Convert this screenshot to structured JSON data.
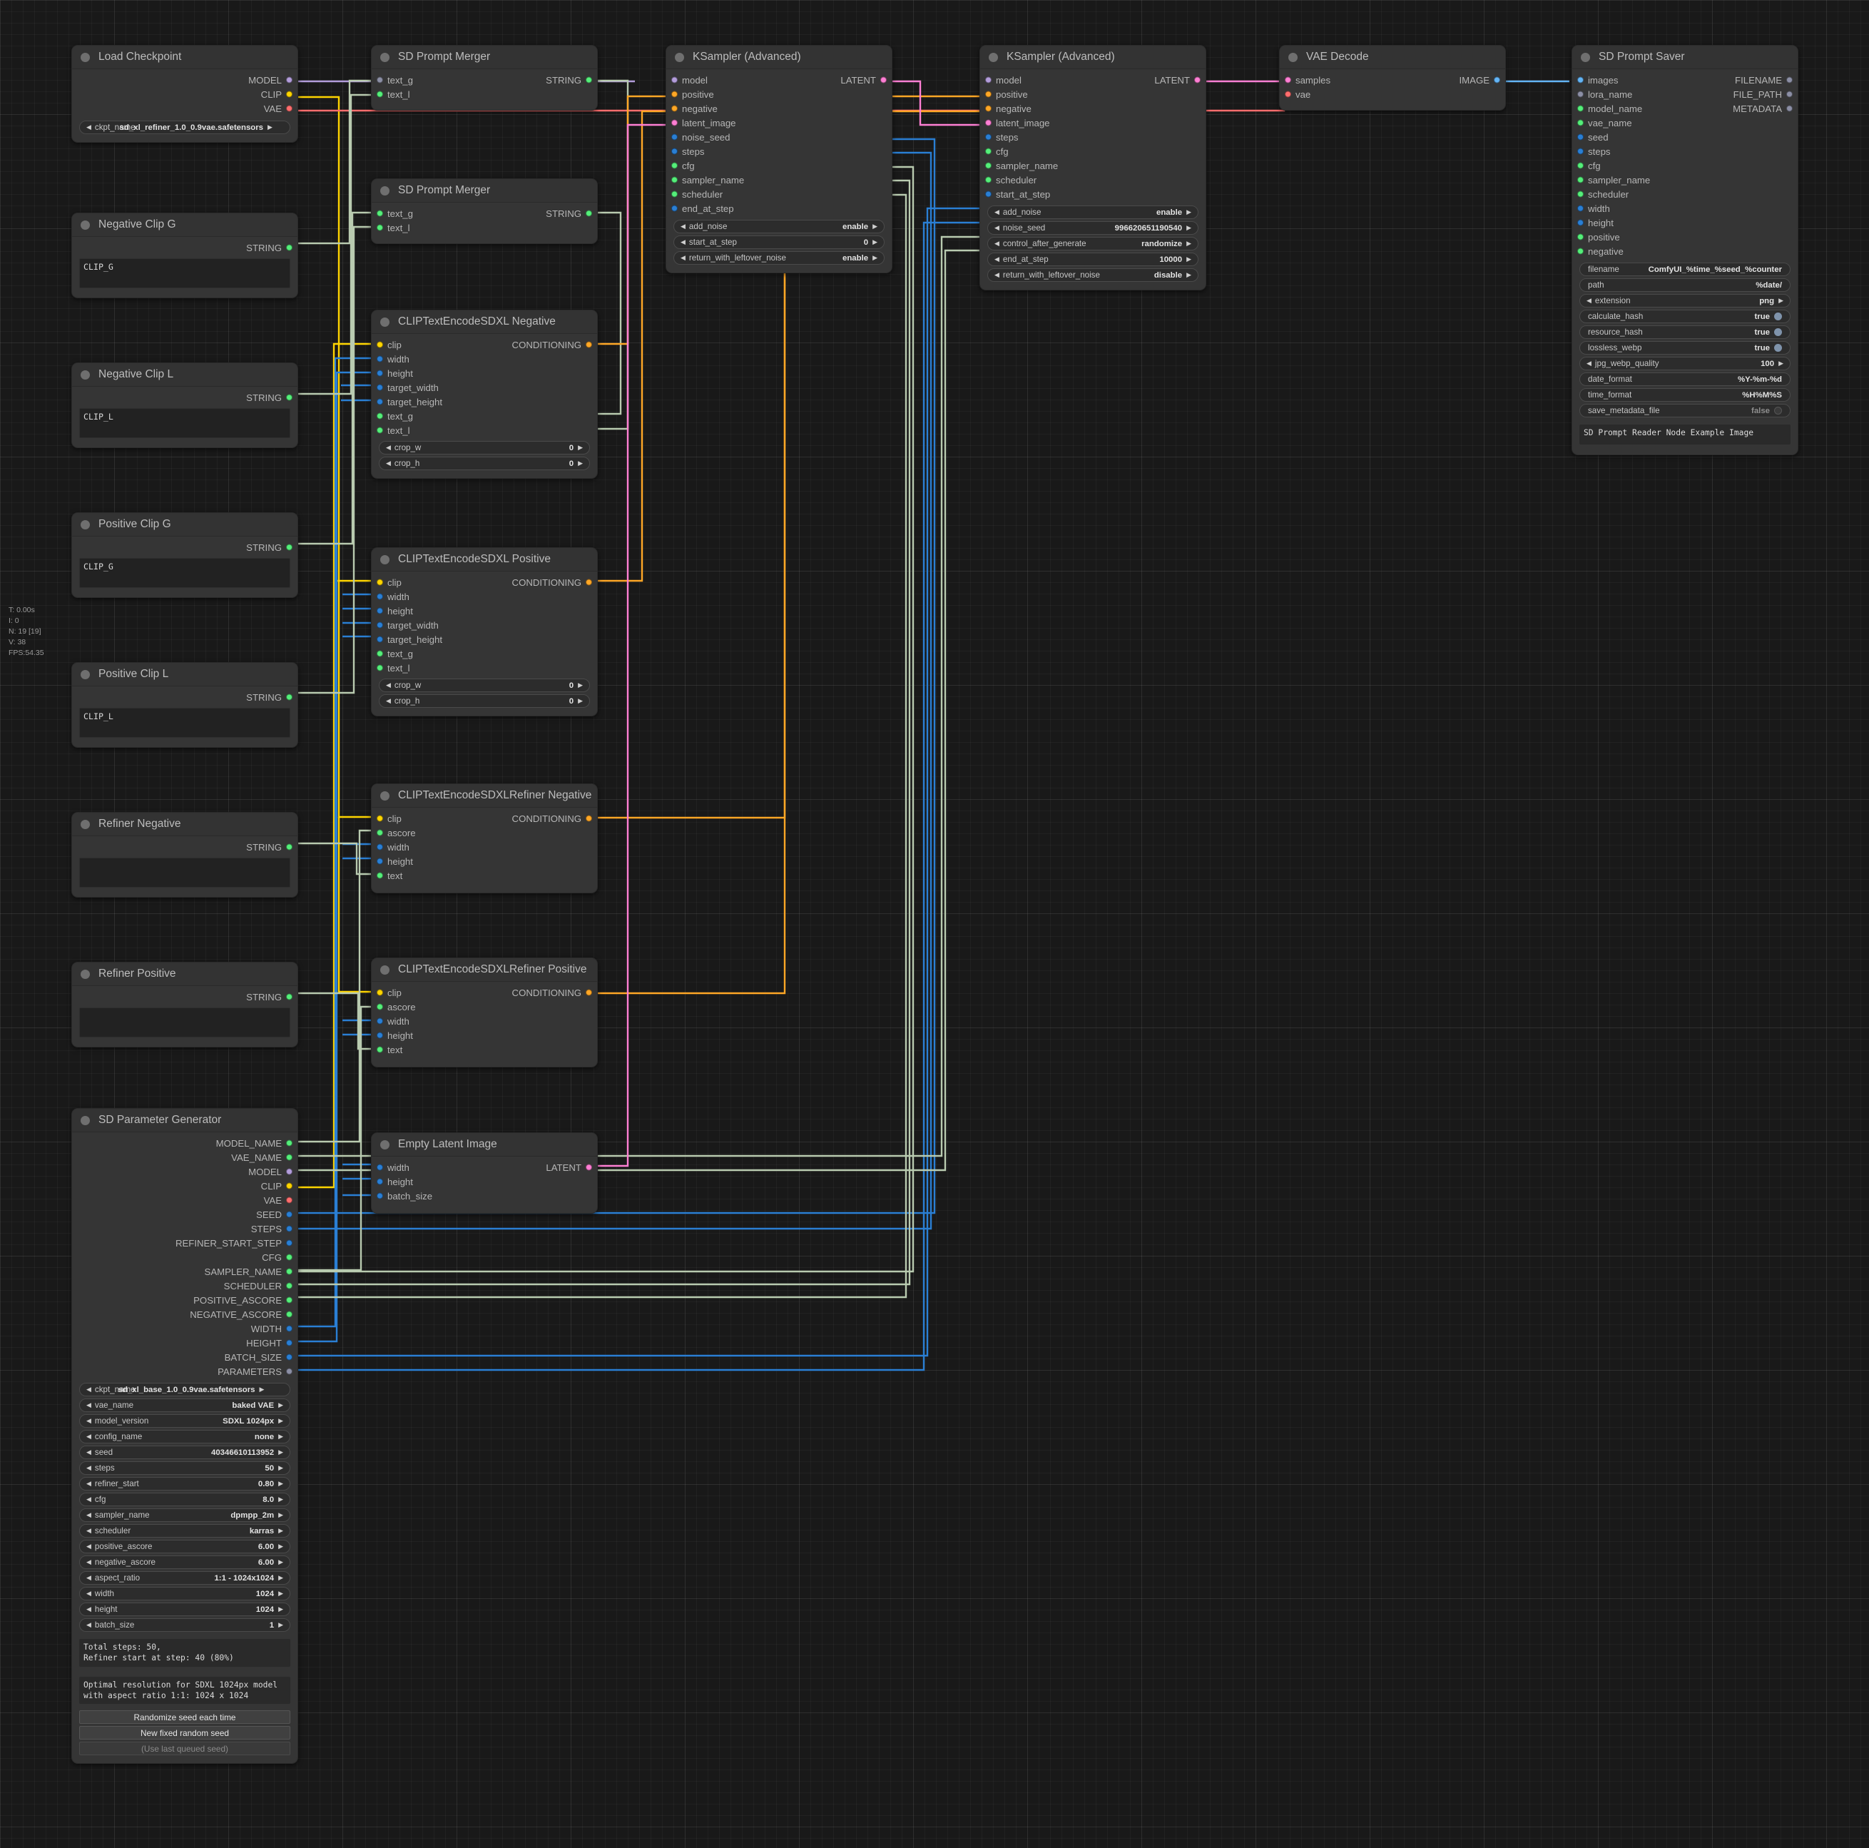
{
  "stats": {
    "time": "T: 0.00s",
    "iterations": "I: 0",
    "nodes": "N: 19 [19]",
    "vertices": "V: 38",
    "fps": "FPS:54.35"
  },
  "nodes": {
    "load_checkpoint": {
      "title": "Load Checkpoint",
      "outputs": [
        {
          "label": "MODEL",
          "type": "model"
        },
        {
          "label": "CLIP",
          "type": "clip"
        },
        {
          "label": "VAE",
          "type": "vae"
        }
      ],
      "widgets": [
        {
          "name": "ckpt_name",
          "value": "sd_xl_refiner_1.0_0.9vae.safetensors",
          "arrows": true
        }
      ]
    },
    "negative_clip_g": {
      "title": "Negative Clip G",
      "outputs": [
        {
          "label": "STRING",
          "type": "string"
        }
      ],
      "text": "CLIP_G"
    },
    "negative_clip_l": {
      "title": "Negative Clip L",
      "outputs": [
        {
          "label": "STRING",
          "type": "string"
        }
      ],
      "text": "CLIP_L"
    },
    "positive_clip_g": {
      "title": "Positive Clip G",
      "outputs": [
        {
          "label": "STRING",
          "type": "string"
        }
      ],
      "text": "CLIP_G"
    },
    "positive_clip_l": {
      "title": "Positive Clip L",
      "outputs": [
        {
          "label": "STRING",
          "type": "string"
        }
      ],
      "text": "CLIP_L"
    },
    "refiner_negative": {
      "title": "Refiner Negative",
      "outputs": [
        {
          "label": "STRING",
          "type": "string"
        }
      ],
      "text": ""
    },
    "refiner_positive": {
      "title": "Refiner Positive",
      "outputs": [
        {
          "label": "STRING",
          "type": "string"
        }
      ],
      "text": ""
    },
    "sd_prompt_merger_1": {
      "title": "SD Prompt Merger",
      "inputs": [
        {
          "label": "text_g",
          "type": "any"
        },
        {
          "label": "text_l",
          "type": "string"
        }
      ],
      "outputs": [
        {
          "label": "STRING",
          "type": "string"
        }
      ]
    },
    "sd_prompt_merger_2": {
      "title": "SD Prompt Merger",
      "inputs": [
        {
          "label": "text_g",
          "type": "string"
        },
        {
          "label": "text_l",
          "type": "string"
        }
      ],
      "outputs": [
        {
          "label": "STRING",
          "type": "string"
        }
      ]
    },
    "clip_encode_negative": {
      "title": "CLIPTextEncodeSDXL Negative",
      "inputs": [
        {
          "label": "clip",
          "type": "clip"
        },
        {
          "label": "width",
          "type": "int"
        },
        {
          "label": "height",
          "type": "int"
        },
        {
          "label": "target_width",
          "type": "int"
        },
        {
          "label": "target_height",
          "type": "int"
        },
        {
          "label": "text_g",
          "type": "string"
        },
        {
          "label": "text_l",
          "type": "string"
        }
      ],
      "outputs": [
        {
          "label": "CONDITIONING",
          "type": "cond"
        }
      ],
      "widgets": [
        {
          "name": "crop_w",
          "value": "0",
          "arrows": true
        },
        {
          "name": "crop_h",
          "value": "0",
          "arrows": true
        }
      ]
    },
    "clip_encode_positive": {
      "title": "CLIPTextEncodeSDXL Positive",
      "inputs": [
        {
          "label": "clip",
          "type": "clip"
        },
        {
          "label": "width",
          "type": "int"
        },
        {
          "label": "height",
          "type": "int"
        },
        {
          "label": "target_width",
          "type": "int"
        },
        {
          "label": "target_height",
          "type": "int"
        },
        {
          "label": "text_g",
          "type": "string"
        },
        {
          "label": "text_l",
          "type": "string"
        }
      ],
      "outputs": [
        {
          "label": "CONDITIONING",
          "type": "cond"
        }
      ],
      "widgets": [
        {
          "name": "crop_w",
          "value": "0",
          "arrows": true
        },
        {
          "name": "crop_h",
          "value": "0",
          "arrows": true
        }
      ]
    },
    "clip_refiner_negative": {
      "title": "CLIPTextEncodeSDXLRefiner Negative",
      "inputs": [
        {
          "label": "clip",
          "type": "clip"
        },
        {
          "label": "ascore",
          "type": "float"
        },
        {
          "label": "width",
          "type": "int"
        },
        {
          "label": "height",
          "type": "int"
        },
        {
          "label": "text",
          "type": "string"
        }
      ],
      "outputs": [
        {
          "label": "CONDITIONING",
          "type": "cond"
        }
      ]
    },
    "clip_refiner_positive": {
      "title": "CLIPTextEncodeSDXLRefiner Positive",
      "inputs": [
        {
          "label": "clip",
          "type": "clip"
        },
        {
          "label": "ascore",
          "type": "float"
        },
        {
          "label": "width",
          "type": "int"
        },
        {
          "label": "height",
          "type": "int"
        },
        {
          "label": "text",
          "type": "string"
        }
      ],
      "outputs": [
        {
          "label": "CONDITIONING",
          "type": "cond"
        }
      ]
    },
    "empty_latent": {
      "title": "Empty Latent Image",
      "inputs": [
        {
          "label": "width",
          "type": "int"
        },
        {
          "label": "height",
          "type": "int"
        },
        {
          "label": "batch_size",
          "type": "int"
        }
      ],
      "outputs": [
        {
          "label": "LATENT",
          "type": "latent"
        }
      ]
    },
    "ksampler_base": {
      "title": "KSampler (Advanced)",
      "inputs": [
        {
          "label": "model",
          "type": "model"
        },
        {
          "label": "positive",
          "type": "cond"
        },
        {
          "label": "negative",
          "type": "cond"
        },
        {
          "label": "latent_image",
          "type": "latent"
        },
        {
          "label": "noise_seed",
          "type": "int"
        },
        {
          "label": "steps",
          "type": "int"
        },
        {
          "label": "cfg",
          "type": "float"
        },
        {
          "label": "sampler_name",
          "type": "float"
        },
        {
          "label": "scheduler",
          "type": "float"
        },
        {
          "label": "end_at_step",
          "type": "int"
        }
      ],
      "outputs": [
        {
          "label": "LATENT",
          "type": "latent"
        }
      ],
      "widgets": [
        {
          "name": "add_noise",
          "value": "enable",
          "arrows": true
        },
        {
          "name": "start_at_step",
          "value": "0",
          "arrows": true
        },
        {
          "name": "return_with_leftover_noise",
          "value": "enable",
          "arrows": true
        }
      ]
    },
    "ksampler_refiner": {
      "title": "KSampler (Advanced)",
      "inputs": [
        {
          "label": "model",
          "type": "model"
        },
        {
          "label": "positive",
          "type": "cond"
        },
        {
          "label": "negative",
          "type": "cond"
        },
        {
          "label": "latent_image",
          "type": "latent"
        },
        {
          "label": "steps",
          "type": "int"
        },
        {
          "label": "cfg",
          "type": "float"
        },
        {
          "label": "sampler_name",
          "type": "float"
        },
        {
          "label": "scheduler",
          "type": "float"
        },
        {
          "label": "start_at_step",
          "type": "int"
        }
      ],
      "outputs": [
        {
          "label": "LATENT",
          "type": "latent"
        }
      ],
      "widgets": [
        {
          "name": "add_noise",
          "value": "enable",
          "arrows": true
        },
        {
          "name": "noise_seed",
          "value": "996620651190540",
          "arrows": true
        },
        {
          "name": "control_after_generate",
          "value": "randomize",
          "arrows": true
        },
        {
          "name": "end_at_step",
          "value": "10000",
          "arrows": true
        },
        {
          "name": "return_with_leftover_noise",
          "value": "disable",
          "arrows": true
        }
      ]
    },
    "vae_decode": {
      "title": "VAE Decode",
      "inputs": [
        {
          "label": "samples",
          "type": "latent"
        },
        {
          "label": "vae",
          "type": "vae"
        }
      ],
      "outputs": [
        {
          "label": "IMAGE",
          "type": "image"
        }
      ]
    },
    "sd_prompt_saver": {
      "title": "SD Prompt Saver",
      "inputs": [
        {
          "label": "images",
          "type": "image"
        },
        {
          "label": "lora_name",
          "type": "any"
        },
        {
          "label": "model_name",
          "type": "string"
        },
        {
          "label": "vae_name",
          "type": "string"
        },
        {
          "label": "seed",
          "type": "int"
        },
        {
          "label": "steps",
          "type": "int"
        },
        {
          "label": "cfg",
          "type": "float"
        },
        {
          "label": "sampler_name",
          "type": "float"
        },
        {
          "label": "scheduler",
          "type": "float"
        },
        {
          "label": "width",
          "type": "int"
        },
        {
          "label": "height",
          "type": "int"
        },
        {
          "label": "positive",
          "type": "string"
        },
        {
          "label": "negative",
          "type": "string"
        }
      ],
      "outputs": [
        {
          "label": "FILENAME",
          "type": "any"
        },
        {
          "label": "FILE_PATH",
          "type": "any"
        },
        {
          "label": "METADATA",
          "type": "any"
        }
      ],
      "widgets": [
        {
          "name": "filename",
          "value": "ComfyUI_%time_%seed_%counter",
          "arrows": false
        },
        {
          "name": "path",
          "value": "%date/",
          "arrows": false
        },
        {
          "name": "extension",
          "value": "png",
          "arrows": true
        },
        {
          "name": "calculate_hash",
          "value": "true",
          "toggle": "on"
        },
        {
          "name": "resource_hash",
          "value": "true",
          "toggle": "on"
        },
        {
          "name": "lossless_webp",
          "value": "true",
          "toggle": "on"
        },
        {
          "name": "jpg_webp_quality",
          "value": "100",
          "arrows": true
        },
        {
          "name": "date_format",
          "value": "%Y-%m-%d",
          "arrows": false
        },
        {
          "name": "time_format",
          "value": "%H%M%S",
          "arrows": false
        },
        {
          "name": "save_metadata_file",
          "value": "false",
          "toggle": "off"
        }
      ],
      "note": "SD Prompt Reader Node Example Image"
    },
    "sd_parameter_generator": {
      "title": "SD Parameter Generator",
      "outputs": [
        {
          "label": "MODEL_NAME",
          "type": "string"
        },
        {
          "label": "VAE_NAME",
          "type": "string"
        },
        {
          "label": "MODEL",
          "type": "model"
        },
        {
          "label": "CLIP",
          "type": "clip"
        },
        {
          "label": "VAE",
          "type": "vae"
        },
        {
          "label": "SEED",
          "type": "int"
        },
        {
          "label": "STEPS",
          "type": "int"
        },
        {
          "label": "REFINER_START_STEP",
          "type": "int"
        },
        {
          "label": "CFG",
          "type": "float"
        },
        {
          "label": "SAMPLER_NAME",
          "type": "float"
        },
        {
          "label": "SCHEDULER",
          "type": "float"
        },
        {
          "label": "POSITIVE_ASCORE",
          "type": "float"
        },
        {
          "label": "NEGATIVE_ASCORE",
          "type": "float"
        },
        {
          "label": "WIDTH",
          "type": "int"
        },
        {
          "label": "HEIGHT",
          "type": "int"
        },
        {
          "label": "BATCH_SIZE",
          "type": "int"
        },
        {
          "label": "PARAMETERS",
          "type": "any"
        }
      ],
      "widgets": [
        {
          "name": "ckpt_name",
          "value": "sd_xl_base_1.0_0.9vae.safetensors",
          "arrows": true
        },
        {
          "name": "vae_name",
          "value": "baked VAE",
          "arrows": true
        },
        {
          "name": "model_version",
          "value": "SDXL 1024px",
          "arrows": true
        },
        {
          "name": "config_name",
          "value": "none",
          "arrows": true
        },
        {
          "name": "seed",
          "value": "40346610113952",
          "arrows": true
        },
        {
          "name": "steps",
          "value": "50",
          "arrows": true
        },
        {
          "name": "refiner_start",
          "value": "0.80",
          "arrows": true
        },
        {
          "name": "cfg",
          "value": "8.0",
          "arrows": true
        },
        {
          "name": "sampler_name",
          "value": "dpmpp_2m",
          "arrows": true
        },
        {
          "name": "scheduler",
          "value": "karras",
          "arrows": true
        },
        {
          "name": "positive_ascore",
          "value": "6.00",
          "arrows": true
        },
        {
          "name": "negative_ascore",
          "value": "6.00",
          "arrows": true
        },
        {
          "name": "aspect_ratio",
          "value": "1:1 - 1024x1024",
          "arrows": true
        },
        {
          "name": "width",
          "value": "1024",
          "arrows": true
        },
        {
          "name": "height",
          "value": "1024",
          "arrows": true
        },
        {
          "name": "batch_size",
          "value": "1",
          "arrows": true
        }
      ],
      "info_steps": "Total steps: 50,\nRefiner start at step: 40 (80%)",
      "info_resolution": "Optimal resolution for SDXL 1024px model\nwith aspect ratio 1:1: 1024 x 1024",
      "buttons": [
        {
          "label": "Randomize seed each time",
          "disabled": false
        },
        {
          "label": "New fixed random seed",
          "disabled": false
        },
        {
          "label": "(Use last queued seed)",
          "disabled": true
        }
      ]
    }
  },
  "colors": {
    "model": "#b39ddb",
    "clip": "#ffd500",
    "vae": "#ff6e6e",
    "latent": "#ff7fd4",
    "image": "#64b5f6",
    "conditioning": "#ffa726",
    "string": "#55ef7a",
    "int": "#2a7fd4",
    "any": "#8c8fa5",
    "canvas_bg": "#191919",
    "node_bg": "#353535"
  }
}
